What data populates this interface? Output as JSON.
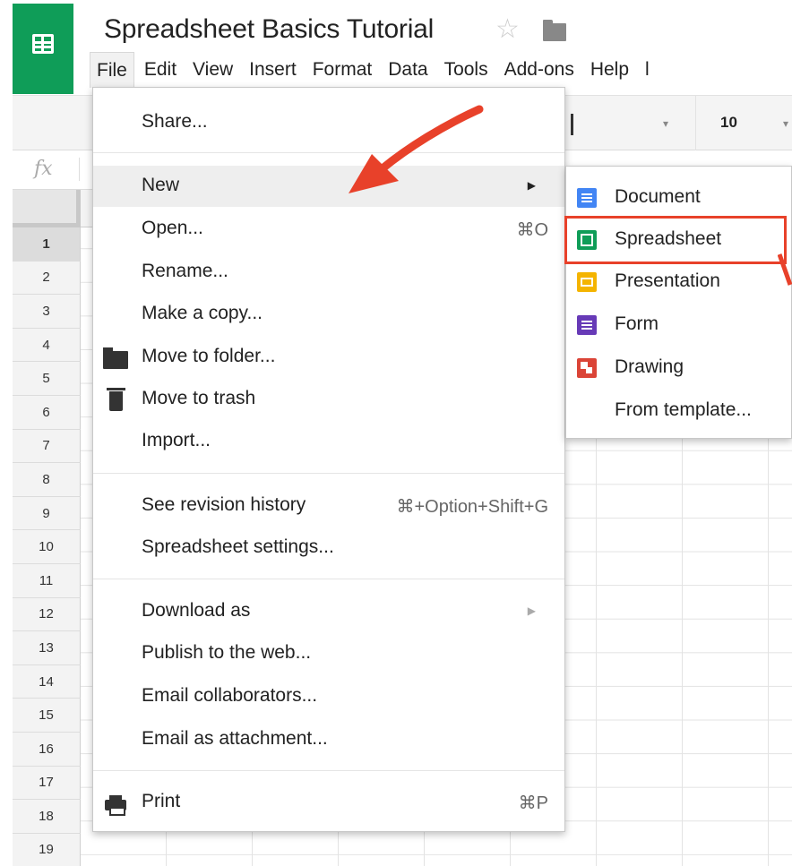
{
  "app": {
    "title": "Spreadsheet Basics Tutorial",
    "brand_color": "#0f9d58"
  },
  "menubar": {
    "items": [
      {
        "label": "File"
      },
      {
        "label": "Edit"
      },
      {
        "label": "View"
      },
      {
        "label": "Insert"
      },
      {
        "label": "Format"
      },
      {
        "label": "Data"
      },
      {
        "label": "Tools"
      },
      {
        "label": "Add-ons"
      },
      {
        "label": "Help"
      },
      {
        "label": "l"
      }
    ]
  },
  "toolbar": {
    "font_size": "10"
  },
  "formula_bar": {
    "fx_label": "fx"
  },
  "rows": [
    "1",
    "2",
    "3",
    "4",
    "5",
    "6",
    "7",
    "8",
    "9",
    "10",
    "11",
    "12",
    "13",
    "14",
    "15",
    "16",
    "17",
    "18",
    "19"
  ],
  "file_menu": {
    "share": "Share...",
    "new": "New",
    "open": "Open...",
    "open_shortcut": "⌘O",
    "rename": "Rename...",
    "make_copy": "Make a copy...",
    "move_to_folder": "Move to folder...",
    "move_to_trash": "Move to trash",
    "import": "Import...",
    "revision_history": "See revision history",
    "revision_shortcut": "⌘+Option+Shift+G",
    "spreadsheet_settings": "Spreadsheet settings...",
    "download_as": "Download as",
    "publish": "Publish to the web...",
    "email_collaborators": "Email collaborators...",
    "email_attachment": "Email as attachment...",
    "print": "Print",
    "print_shortcut": "⌘P"
  },
  "new_submenu": {
    "document": "Document",
    "spreadsheet": "Spreadsheet",
    "presentation": "Presentation",
    "form": "Form",
    "drawing": "Drawing",
    "from_template": "From template..."
  },
  "annotation": {
    "color": "#e8412a"
  }
}
